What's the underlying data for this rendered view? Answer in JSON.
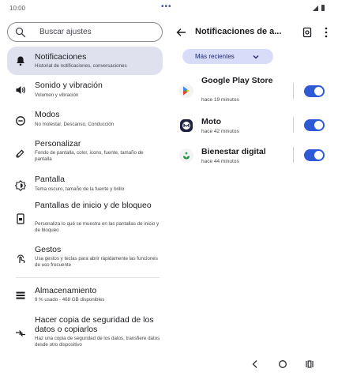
{
  "status_bar": {
    "time": "10:00",
    "center_indicator": "•••"
  },
  "search": {
    "placeholder": "Buscar ajustes"
  },
  "settings_menu": [
    {
      "title": "Notificaciones",
      "subtitle": "Historial de notificaciones, conversaciones",
      "icon": "bell-icon",
      "selected": true
    },
    {
      "title": "Sonido y vibración",
      "subtitle": "Volumen y vibración",
      "icon": "speaker-icon"
    },
    {
      "title": "Modos",
      "subtitle": "No molestar, Descanso, Conducción",
      "icon": "do-not-disturb-icon"
    },
    {
      "title": "Personalizar",
      "subtitle": "Fondo de pantalla, color, icono, fuente, tamaño de pantalla",
      "icon": "palette-icon"
    },
    {
      "title": "Pantalla",
      "subtitle": "Tema oscuro, tamaño de la fuente y brillo",
      "icon": "brightness-icon"
    },
    {
      "title": "Pantallas de inicio y de bloqueo",
      "subtitle": "Personaliza lo qué se muestra en las pantallas de inicio y de bloqueo",
      "icon": "phone-lock-icon"
    },
    {
      "title": "Gestos",
      "subtitle": "Usa gestos y teclas para abrir rápidamente las funciones de uso frecuente",
      "icon": "gesture-icon"
    },
    {
      "title": "Almacenamiento",
      "subtitle": "9 % usado - 468 GB disponibles",
      "icon": "storage-icon"
    },
    {
      "title": "Hacer copia de seguridad de los datos o copiarlos",
      "subtitle": "Haz una copia de seguridad de los datos, transfiere datos desde otro dispositivo",
      "icon": "transfer-icon"
    }
  ],
  "detail": {
    "title": "Notificaciones de a...",
    "filter_label": "Más recientes",
    "apps": [
      {
        "name": "Google Play Store",
        "time": "hace 19 minutos",
        "enabled": true
      },
      {
        "name": "Moto",
        "time": "hace 42 minutos",
        "enabled": true
      },
      {
        "name": "Bienestar digital",
        "time": "hace 44 minutos",
        "enabled": true
      }
    ]
  },
  "colors": {
    "accent": "#2e5ad6",
    "selected_bg": "#dfe1ef",
    "chip_bg": "#d7dcf8"
  }
}
